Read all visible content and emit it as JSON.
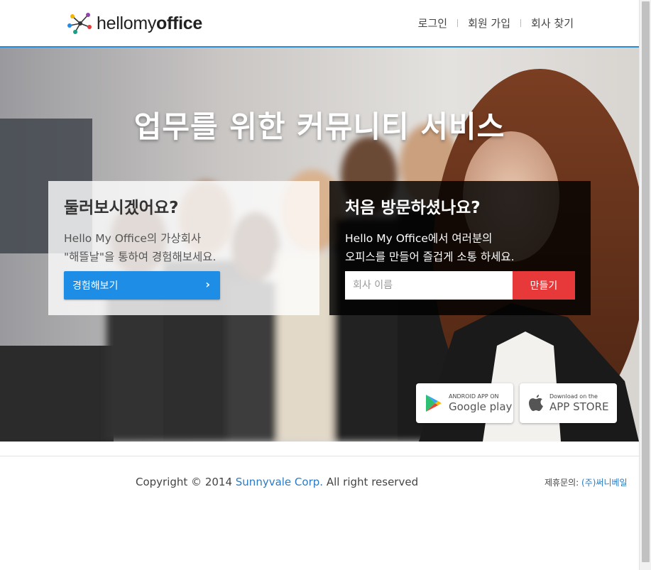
{
  "header": {
    "logo": {
      "light": "hellomy",
      "bold": "office"
    },
    "nav": [
      {
        "label": "로그인"
      },
      {
        "label": "회원 가입"
      },
      {
        "label": "회사 찾기"
      }
    ]
  },
  "hero": {
    "title": "업무를 위한 커뮤니티 서비스",
    "tour_card": {
      "heading": "둘러보시겠어요?",
      "line1": "Hello My Office의 가상회사",
      "line2": "\"해뜰날\"을 통하여 경험해보세요.",
      "button_label": "경험해보기",
      "button_icon": "chevron-right-icon"
    },
    "signup_card": {
      "heading": "처음 방문하셨나요?",
      "line1": "Hello My Office에서 여러분의",
      "line2": "오피스를 만들어 즐겁게 소통 하세요.",
      "input_value": "",
      "input_placeholder": "회사 이름",
      "button_label": "만들기"
    },
    "badges": {
      "google_small": "ANDROID APP ON",
      "google_big": "Google play",
      "apple_small": "Download on the",
      "apple_big": "APP STORE"
    }
  },
  "footer": {
    "copyright_prefix": "Copyright © 2014 ",
    "company_link": "Sunnyvale Corp.",
    "copyright_suffix": " All right reserved",
    "partner_label": "제휴문의: ",
    "partner_link": "(주)써니베일"
  },
  "colors": {
    "accent_blue": "#1d8de6",
    "create_red": "#e8393a",
    "header_line": "#2a8ad6",
    "link_blue": "#2a7bc4"
  }
}
